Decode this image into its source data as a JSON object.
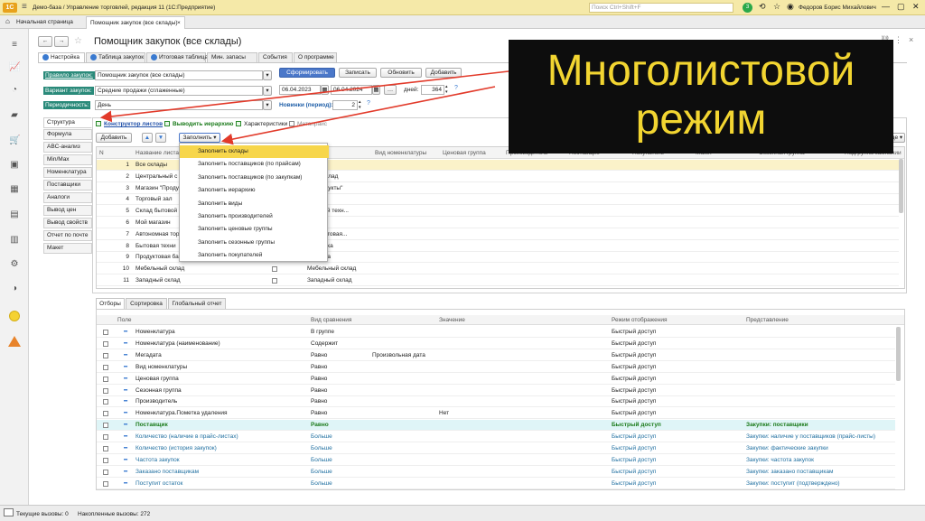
{
  "titlebar": {
    "app_title": "Демо-база / Управление торговлей, редакция 11  (1С:Предприятие)",
    "search_placeholder": "Поиск Ctrl+Shift+F",
    "notif_count": "3",
    "user": "Федоров Борис Михайлович"
  },
  "tabs": {
    "home": "Начальная страница",
    "current": "Помощник закупок (все склады)"
  },
  "page": {
    "title": "Помощник закупок (все склады)"
  },
  "form_tabs": [
    "Настройка",
    "Таблица закупок",
    "Итоговая таблица",
    "Мин. запасы",
    "События",
    "О программе"
  ],
  "settings": {
    "rule_label": "Правило закупок:",
    "rule_value": "Помощник закупок (все склады)",
    "variant_label": "Вариант закупок:",
    "variant_value": "Средние продажи (сглаженные)",
    "period_label": "Периодичность:",
    "period_value": "День",
    "btn_form": "Сформировать",
    "btn_write": "Записать",
    "btn_refresh": "Обновить",
    "btn_add": "Добавить",
    "date_from": "06.04.2023",
    "date_to": "06.04.2024",
    "days_label": "дней:",
    "days_value": "364",
    "new_label": "Новинки (период):",
    "new_value": "2"
  },
  "side_tabs": [
    "Структура",
    "Формула",
    "ABC-анализ",
    "Min/Max",
    "Номенклатура",
    "Поставщики",
    "Аналоги",
    "Вывод цен",
    "Вывод свойств",
    "Отчет по почте",
    "Макет"
  ],
  "struct_options": {
    "constructor": "Конструктор листов",
    "hierarchy": "Выводить иерархию",
    "characteristics": "Характеристики",
    "price": "Метапрайс"
  },
  "toolbar": {
    "add": "Добавить",
    "fill": "Заполнить",
    "more": "Еще"
  },
  "grid_headers": [
    "N",
    "Название листа",
    "Вид номенклатуры",
    "Ценовая группа",
    "Производитель",
    "Поставщик",
    "Покупатель",
    "Макет",
    "Сезонная группа",
    "Подгруппа кампании"
  ],
  "grid_rows": [
    {
      "n": "1",
      "name": "Все склады",
      "col3": ""
    },
    {
      "n": "2",
      "name": "Центральный с",
      "col3": "ьный склад"
    },
    {
      "n": "3",
      "name": "Магазин \"Проду",
      "col3": "е \"Продукты\""
    },
    {
      "n": "4",
      "name": "Торговый зал",
      "col3": "зал"
    },
    {
      "n": "5",
      "name": "Склад бытовой",
      "col3": "бытовой техн..."
    },
    {
      "n": "6",
      "name": "Мой магазин",
      "col3": "ин"
    },
    {
      "n": "7",
      "name": "Автономная тор",
      "col3": "ная торговая..."
    },
    {
      "n": "8",
      "name": "Бытовая техни",
      "col3": "я техника"
    },
    {
      "n": "9",
      "name": "Продуктовая ба",
      "col3": "вая база"
    },
    {
      "n": "10",
      "name": "Мебельный склад",
      "col3": "Мебельный склад"
    },
    {
      "n": "11",
      "name": "Западный склад",
      "col3": "Западный склад"
    }
  ],
  "fill_menu": [
    "Заполнить склады",
    "Заполнить поставщиков (по прайсам)",
    "Заполнить поставщиков (по закупкам)",
    "Заполнить иерархию",
    "Заполнить виды",
    "Заполнить производителей",
    "Заполнить ценовые группы",
    "Заполнить сезонные группы",
    "Заполнить покупателей"
  ],
  "bottom_tabs": [
    "Отборы",
    "Сортировка",
    "Глобальный отчет"
  ],
  "filter_headers": [
    "Поле",
    "Вид сравнения",
    "Значение",
    "Режим отображения",
    "Представление"
  ],
  "filter_rows": [
    {
      "field": "Номенклатура",
      "cmp": "В группе",
      "val": "",
      "mode": "Быстрый доступ",
      "repr": "",
      "style": ""
    },
    {
      "field": "Номенклатура (наименование)",
      "cmp": "Содержит",
      "val": "",
      "mode": "Быстрый доступ",
      "repr": "",
      "style": ""
    },
    {
      "field": "Мегадата",
      "cmp": "Равно",
      "val": "Произвольная дата",
      "mode": "Быстрый доступ",
      "repr": "",
      "style": ""
    },
    {
      "field": "Вид номенклатуры",
      "cmp": "Равно",
      "val": "",
      "mode": "Быстрый доступ",
      "repr": "",
      "style": ""
    },
    {
      "field": "Ценовая группа",
      "cmp": "Равно",
      "val": "",
      "mode": "Быстрый доступ",
      "repr": "",
      "style": ""
    },
    {
      "field": "Сезонная группа",
      "cmp": "Равно",
      "val": "",
      "mode": "Быстрый доступ",
      "repr": "",
      "style": ""
    },
    {
      "field": "Производитель",
      "cmp": "Равно",
      "val": "",
      "mode": "Быстрый доступ",
      "repr": "",
      "style": ""
    },
    {
      "field": "Номенклатура.Пометка удаления",
      "cmp": "Равно",
      "val": "Нет",
      "mode": "Быстрый доступ",
      "repr": "",
      "style": ""
    },
    {
      "field": "Поставщик",
      "cmp": "Равно",
      "val": "",
      "mode": "Быстрый доступ",
      "repr": "Закупки: поставщики",
      "style": "green"
    },
    {
      "field": "Количество (наличие в прайс-листах)",
      "cmp": "Больше",
      "val": "",
      "mode": "Быстрый доступ",
      "repr": "Закупки: наличие у поставщиков (прайс-листы)",
      "style": "teal"
    },
    {
      "field": "Количество (история закупок)",
      "cmp": "Больше",
      "val": "",
      "mode": "Быстрый доступ",
      "repr": "Закупки: фактические закупки",
      "style": "teal"
    },
    {
      "field": "Частота закупок",
      "cmp": "Больше",
      "val": "",
      "mode": "Быстрый доступ",
      "repr": "Закупки: частота закупок",
      "style": "teal"
    },
    {
      "field": "Заказано поставщикам",
      "cmp": "Больше",
      "val": "",
      "mode": "Быстрый доступ",
      "repr": "Закупки: заказано поставщикам",
      "style": "teal"
    },
    {
      "field": "Поступит остаток",
      "cmp": "Больше",
      "val": "",
      "mode": "Быстрый доступ",
      "repr": "Закупки: поступит (подтверждено)",
      "style": "teal"
    }
  ],
  "status": {
    "current_calls": "Текущие вызовы: 0",
    "accum_calls": "Накопленные вызовы: 272"
  },
  "overlay": {
    "line1": "Многолистовой",
    "line2": "режим"
  },
  "colors": {
    "accent": "#f2d531",
    "arrow": "#e23a2a"
  }
}
